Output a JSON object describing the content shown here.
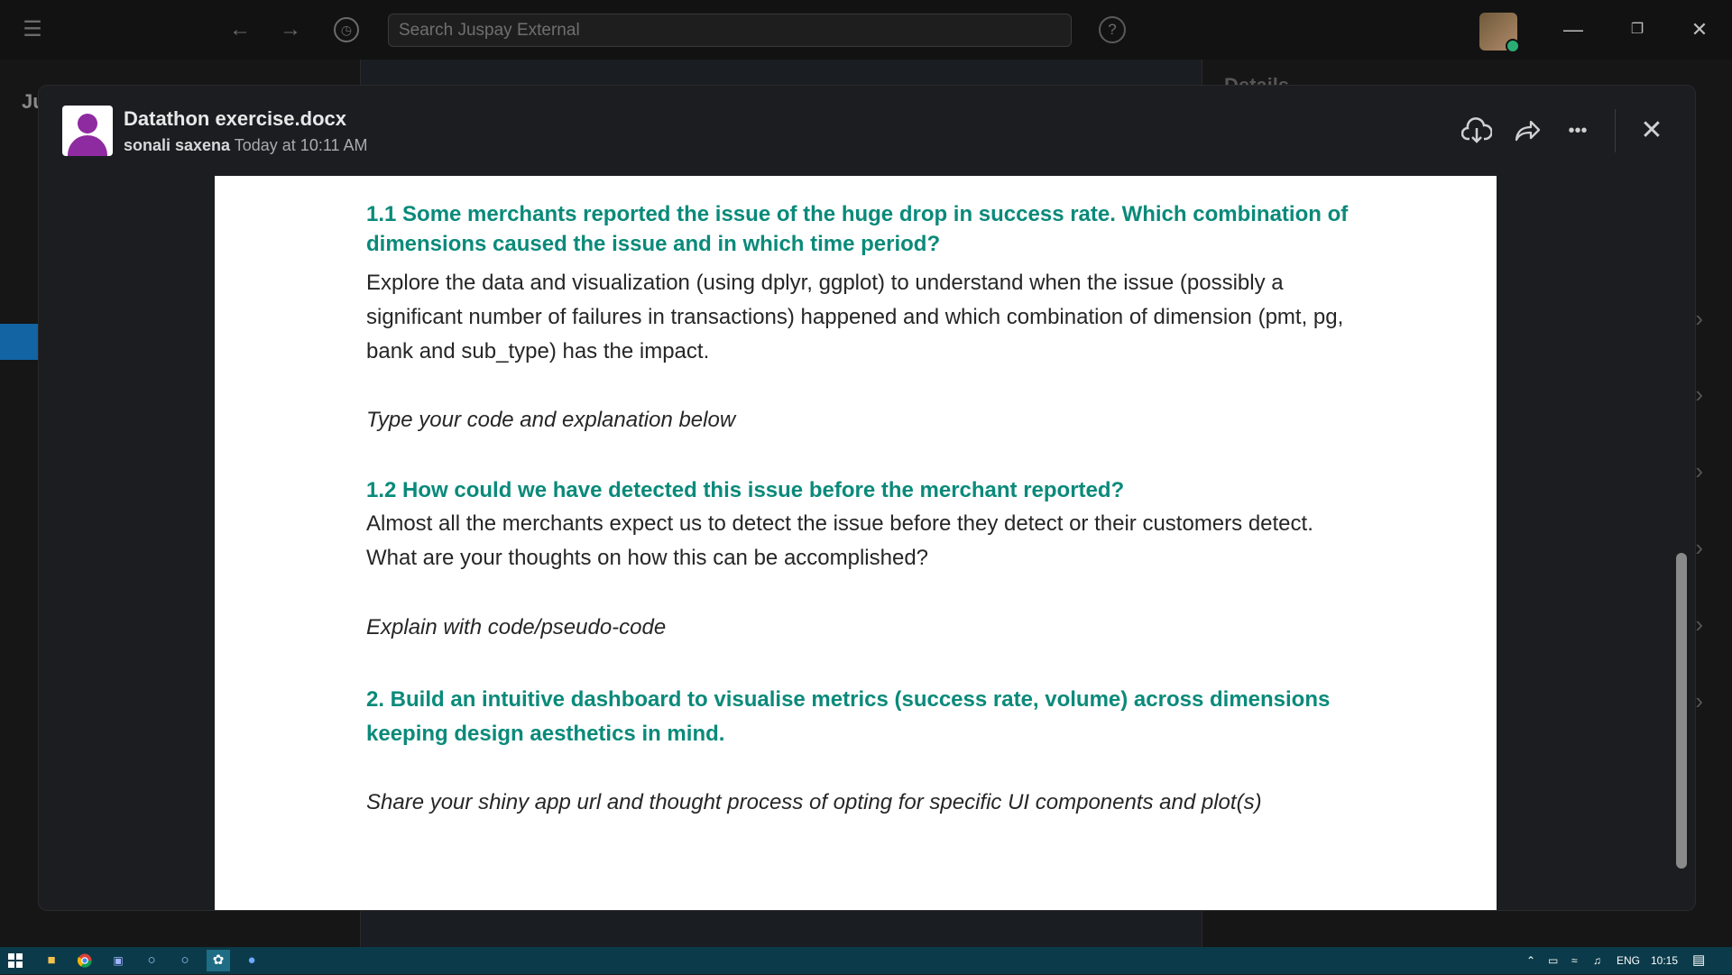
{
  "topbar": {
    "search_placeholder": "Search Juspay External",
    "menu_icon": "menu-icon",
    "back_icon": "back-arrow-icon",
    "forward_icon": "forward-arrow-icon",
    "history_icon": "clock-icon",
    "help_label": "?",
    "minimize_label": "—",
    "restore_label": "❐",
    "close_label": "✕"
  },
  "background": {
    "sidebar_heading": "Ju",
    "details_heading": "Details"
  },
  "modal": {
    "file_title": "Datathon exercise.docx",
    "author": "sonali saxena",
    "timestamp": "Today at 10:11 AM",
    "download_label": "⭳",
    "share_label": "➦",
    "more_label": "•••",
    "close_label": "✕"
  },
  "document": {
    "h1_1": "1.1 Some merchants reported the issue of the huge drop in success rate. Which combination of dimensions caused the issue and in which time period?",
    "p1_1": "Explore the data and visualization (using dplyr, ggplot) to understand when the issue (possibly a significant number of failures in transactions) happened and which combination of dimension (pmt, pg, bank and sub_type) has the impact.",
    "i1_1": "Type your code and explanation below",
    "h1_2": "1.2 How could we have detected this issue before the merchant reported?",
    "p1_2": "Almost all the merchants expect us to detect the issue before they detect or their customers detect. What are your thoughts on how this can be accomplished?",
    "i1_2": "Explain with code/pseudo-code",
    "h2": "2. Build an intuitive dashboard to visualise metrics (success rate, volume) across dimensions keeping design aesthetics in mind.",
    "i2": "Share your shiny app url and thought process of opting for specific UI components and plot(s)"
  },
  "taskbar": {
    "tray_lang": "ENG",
    "tray_time": "10:15"
  }
}
